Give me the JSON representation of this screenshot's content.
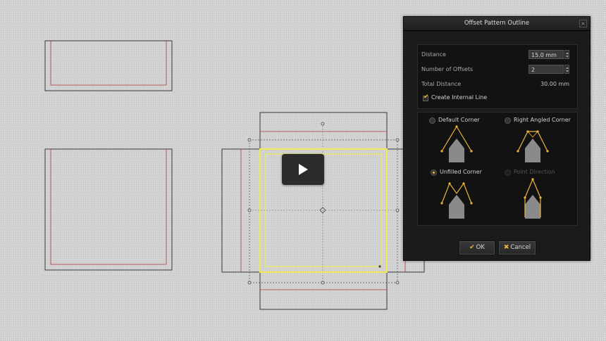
{
  "dialog": {
    "title": "Offset Pattern Outline",
    "distance_label": "Distance",
    "distance_value": "15.0 mm",
    "offsets_label": "Number of Offsets",
    "offsets_value": "2",
    "total_label": "Total Distance",
    "total_value": "30.00 mm",
    "internal_line_label": "Create Internal Line",
    "internal_line_checked": true,
    "corner_options": [
      {
        "label": "Default Corner",
        "selected": false,
        "enabled": true
      },
      {
        "label": "Right Angled Corner",
        "selected": false,
        "enabled": true
      },
      {
        "label": "Unfilled Corner",
        "selected": true,
        "enabled": true
      },
      {
        "label": "Point Direction",
        "selected": false,
        "enabled": false
      }
    ],
    "ok_label": "OK",
    "cancel_label": "Cancel",
    "ok_icon": "check-icon",
    "cancel_icon": "x-icon"
  },
  "colors": {
    "accent": "#f0b53c",
    "selection": "#f0ea55",
    "offset_line": "#b23a3a",
    "outline": "#3a3a3a"
  }
}
